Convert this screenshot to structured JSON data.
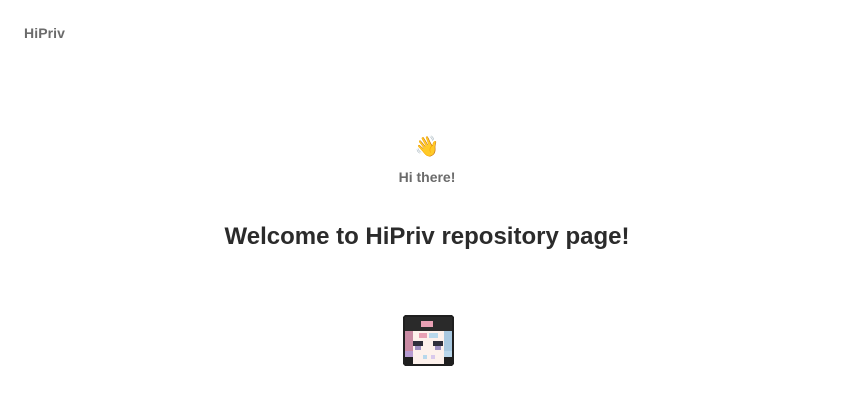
{
  "header": {
    "brand": "HiPriv"
  },
  "hero": {
    "wave_icon": "waving-hand-icon",
    "wave_glyph": "👋",
    "greeting": "Hi there!",
    "headline": "Welcome to HiPriv repository page!"
  },
  "avatar": {
    "icon": "pixel-art-avatar"
  },
  "colors": {
    "background": "#ffffff",
    "muted_text": "#6b6b6b",
    "headline_text": "#2b2b2b"
  }
}
